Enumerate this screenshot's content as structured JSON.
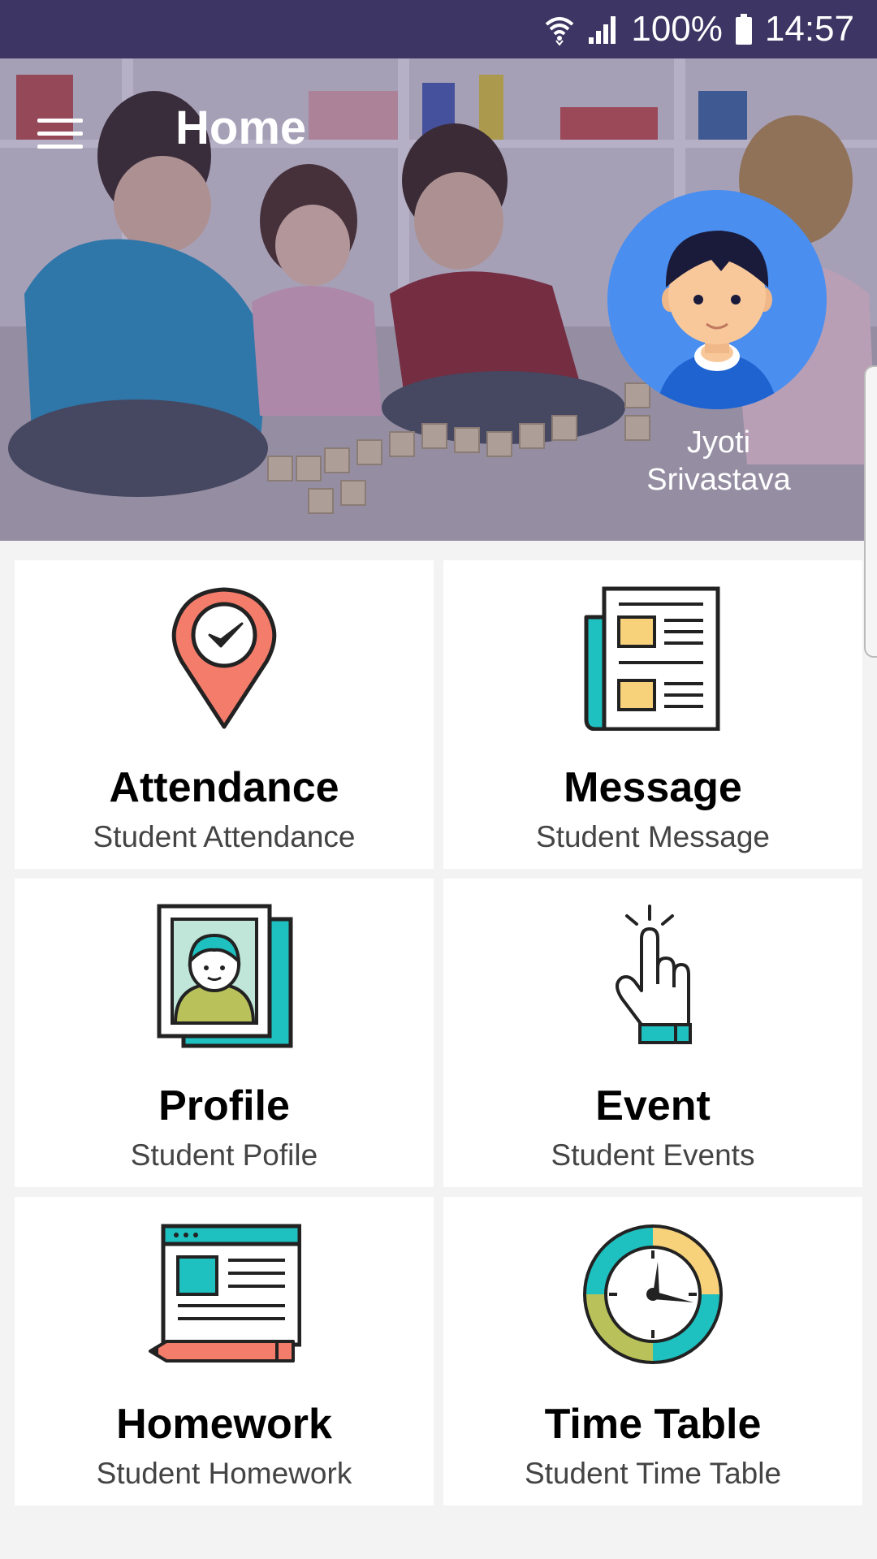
{
  "status_bar": {
    "battery": "100%",
    "time": "14:57",
    "icons": [
      "wifi-icon",
      "signal-icon",
      "battery-icon"
    ]
  },
  "header": {
    "title": "Home",
    "menu_icon": "hamburger-menu-icon"
  },
  "profile": {
    "name_line1": "Jyoti",
    "name_line2": "Srivastava",
    "avatar_icon": "boy-avatar-icon"
  },
  "menu": [
    {
      "title": "Attendance",
      "subtitle": "Student Attendance",
      "icon": "location-check-icon"
    },
    {
      "title": "Message",
      "subtitle": "Student Message",
      "icon": "newspaper-icon"
    },
    {
      "title": "Profile",
      "subtitle": "Student Pofile",
      "icon": "photo-portrait-icon"
    },
    {
      "title": "Event",
      "subtitle": "Student Events",
      "icon": "hand-tap-icon"
    },
    {
      "title": "Homework",
      "subtitle": "Student Homework",
      "icon": "document-pencil-icon"
    },
    {
      "title": "Time Table",
      "subtitle": "Student Time Table",
      "icon": "clock-icon"
    }
  ],
  "colors": {
    "status_bar": "#3d3563",
    "avatar_bg": "#4a8ef0",
    "teal": "#1fc0c0",
    "coral": "#f47c6b",
    "yellow": "#f7d27a"
  }
}
